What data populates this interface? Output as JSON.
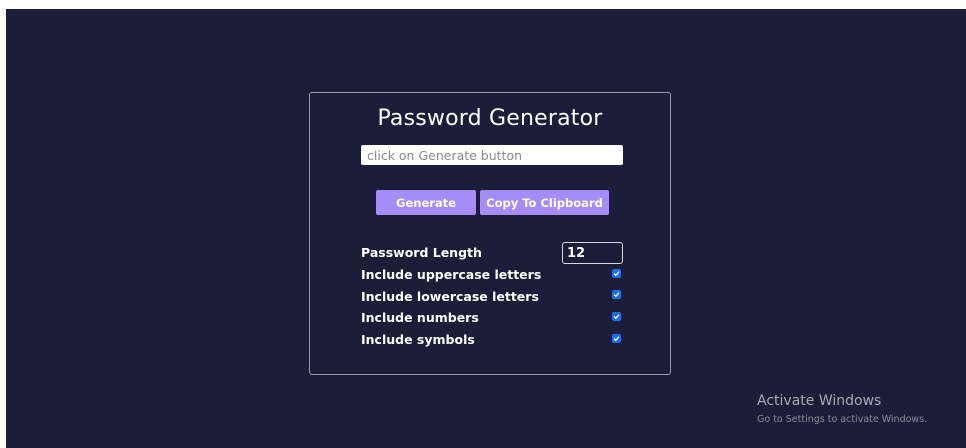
{
  "app": {
    "title": "Password Generator"
  },
  "password_field": {
    "value": "",
    "placeholder": "click on Generate button"
  },
  "buttons": {
    "generate_label": "Generate",
    "copy_label": "Copy To Clipboard"
  },
  "options": {
    "length_label": "Password Length",
    "length_value": "12",
    "uppercase_label": "Include uppercase letters",
    "uppercase_checked": true,
    "lowercase_label": "Include lowercase letters",
    "lowercase_checked": true,
    "numbers_label": "Include numbers",
    "numbers_checked": true,
    "symbols_label": "Include symbols",
    "symbols_checked": true
  },
  "watermark": {
    "title": "Activate Windows",
    "subtitle": "Go to Settings to activate Windows."
  },
  "colors": {
    "background": "#1c1d38",
    "accent": "#a58cf8",
    "checkbox": "#1a6fe8"
  }
}
